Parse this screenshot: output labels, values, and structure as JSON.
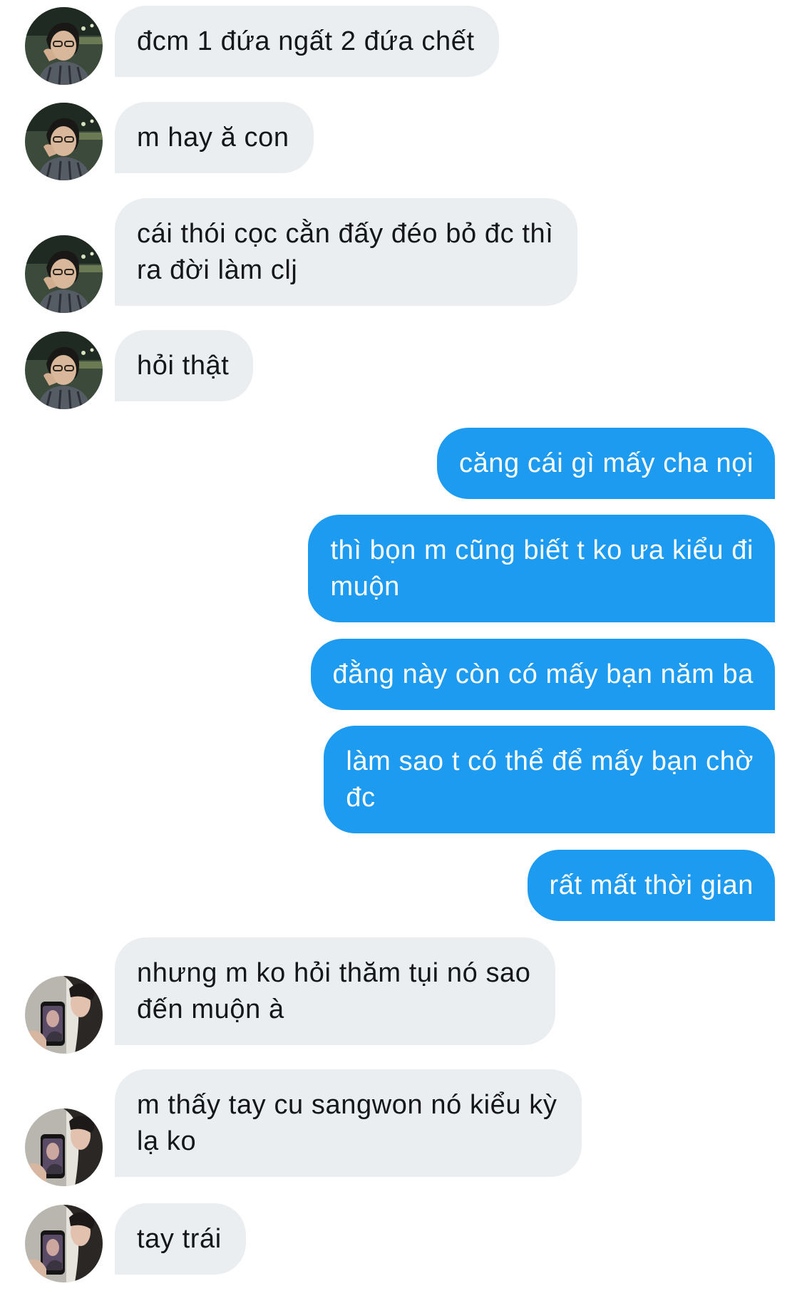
{
  "conversation": {
    "messages": [
      {
        "from": "contact",
        "avatar": "guy-with-glasses-photo",
        "text": "đcm 1 đứa ngất 2 đứa chết"
      },
      {
        "from": "contact",
        "avatar": "guy-with-glasses-photo",
        "text": "m hay ă con"
      },
      {
        "from": "contact",
        "avatar": "guy-with-glasses-photo",
        "text": "cái thói cọc cằn đấy đéo bỏ đc thì\nra đời làm clj"
      },
      {
        "from": "contact",
        "avatar": "guy-with-glasses-photo",
        "text": "hỏi thật"
      },
      {
        "from": "me",
        "text": "căng cái gì mấy cha nọi"
      },
      {
        "from": "me",
        "text": "thì bọn m cũng biết t ko ưa kiểu đi\nmuộn"
      },
      {
        "from": "me",
        "text": "đằng này còn có mấy bạn năm ba"
      },
      {
        "from": "me",
        "text": "làm sao t có thể để mấy bạn chờ\nđc"
      },
      {
        "from": "me",
        "text": "rất mất thời gian"
      },
      {
        "from": "contact",
        "avatar": "mirror-selfie-photo",
        "text": "nhưng m ko hỏi thăm tụi nó sao\nđến muộn à"
      },
      {
        "from": "contact",
        "avatar": "mirror-selfie-photo",
        "text": "m thấy tay cu sangwon nó kiểu kỳ\nlạ ko"
      },
      {
        "from": "contact",
        "avatar": "mirror-selfie-photo",
        "text": "tay trái"
      }
    ]
  },
  "colors": {
    "incoming_bubble": "#ebeef1",
    "incoming_text": "#141619",
    "outgoing_bubble": "#1d9bf0",
    "outgoing_text": "#ffffff"
  }
}
